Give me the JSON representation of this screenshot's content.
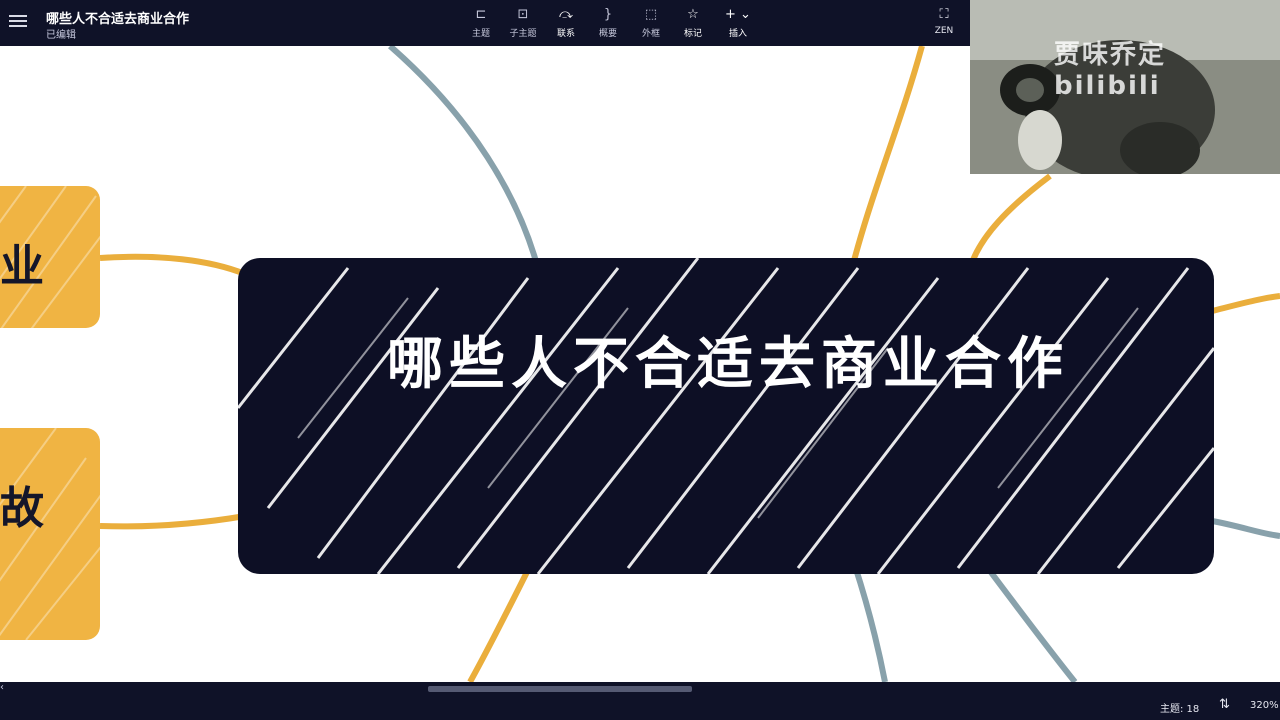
{
  "header": {
    "title": "哪些人不合适去商业合作",
    "status": "已编辑",
    "tools": [
      {
        "label": "主题",
        "icon": "topic-icon"
      },
      {
        "label": "子主题",
        "icon": "subtopic-icon"
      },
      {
        "label": "联系",
        "icon": "relationship-icon"
      },
      {
        "label": "概要",
        "icon": "summary-icon"
      },
      {
        "label": "外框",
        "icon": "boundary-icon"
      },
      {
        "label": "标记",
        "icon": "star-icon"
      },
      {
        "label": "插入",
        "icon": "plus-icon"
      }
    ],
    "zen_label": "ZEN"
  },
  "canvas": {
    "central_topic": "哪些人不合适去商业合作",
    "left_nodes": [
      {
        "text": "业"
      },
      {
        "text": "故"
      }
    ],
    "colors": {
      "background": "#ffffff",
      "central_fill": "#0d0f25",
      "node_fill": "#f0b443",
      "branch_orange": "#eaae3c",
      "branch_gray": "#88a1ab"
    }
  },
  "video_overlay": {
    "watermark": "贾味乔定 bilibili"
  },
  "footer": {
    "topic_count": "主题: 18",
    "zoom": "320%",
    "collapse_mark": "‹"
  }
}
